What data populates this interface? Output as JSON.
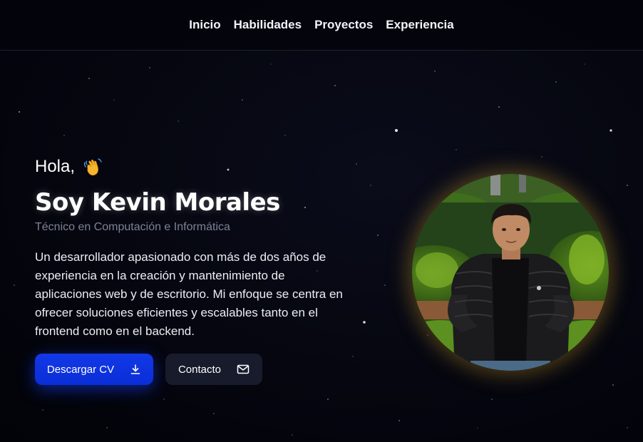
{
  "nav": {
    "items": [
      "Inicio",
      "Habilidades",
      "Proyectos",
      "Experiencia"
    ]
  },
  "hero": {
    "greeting": "Hola,",
    "wave_icon": "waving-hand-emoji",
    "name": "Soy Kevin Morales",
    "subtitle": "Técnico en Computación e Informática",
    "description": "Un desarrollador apasionado con más de dos años de experiencia en la creación y mantenimiento de aplicaciones web y de escritorio. Mi enfoque se centra en ofrecer soluciones eficientes y escalables tanto en el frontend como en el backend.",
    "buttons": {
      "download_label": "Descargar CV",
      "download_icon": "download-icon",
      "contact_label": "Contacto",
      "contact_icon": "mail-icon"
    }
  },
  "colors": {
    "background": "#03040c",
    "primary_button": "#0a2ed6",
    "secondary_button": "#181b2c",
    "subtitle": "#7d8294",
    "avatar_glow": "#dcaa28"
  }
}
